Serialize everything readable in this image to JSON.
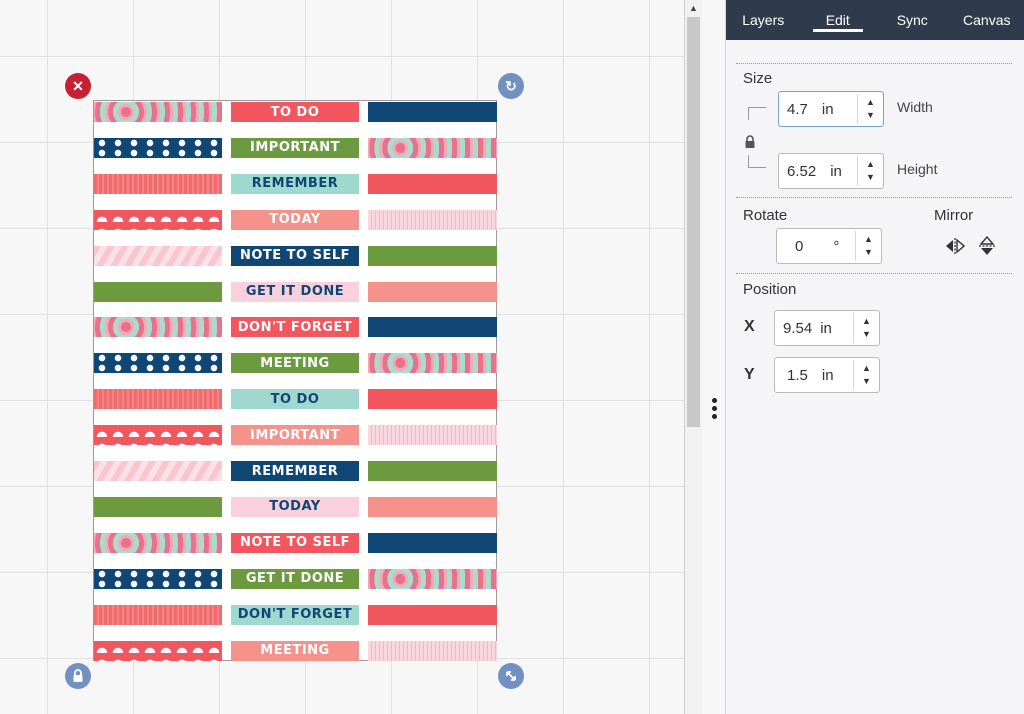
{
  "tabs": [
    "Layers",
    "Edit",
    "Sync",
    "Canvas"
  ],
  "active_tab": "Edit",
  "size": {
    "title": "Size",
    "width_value": "4.7",
    "width_unit": "in",
    "width_label": "Width",
    "height_value": "6.52",
    "height_unit": "in",
    "height_label": "Height"
  },
  "rotate": {
    "title": "Rotate",
    "value": "0",
    "unit": "°"
  },
  "mirror": {
    "title": "Mirror"
  },
  "position": {
    "title": "Position",
    "x_label": "X",
    "x_value": "9.54",
    "x_unit": "in",
    "y_label": "Y",
    "y_value": "1.5",
    "y_unit": "in"
  },
  "labels": [
    "TO DO",
    "IMPORTANT",
    "REMEMBER",
    "TODAY",
    "NOTE TO SELF",
    "GET IT DONE",
    "DON'T FORGET",
    "MEETING",
    "TO DO",
    "IMPORTANT",
    "REMEMBER",
    "TODAY",
    "NOTE TO SELF",
    "GET IT DONE",
    "DON'T FORGET",
    "MEETING"
  ],
  "colors": {
    "coral": "#f2565e",
    "green": "#6b9b3e",
    "teal": "#9fd8cf",
    "salmon": "#f5928c",
    "navy": "#0f4673",
    "pink": "#f9d0dc",
    "white": "#ffffff",
    "delete_handle": "#c72032",
    "corner_handle": "#7291c2",
    "tab_bar": "#2f3b4c"
  },
  "handle_icons": [
    "close-icon",
    "rotate-icon",
    "lock-icon",
    "resize-icon"
  ]
}
